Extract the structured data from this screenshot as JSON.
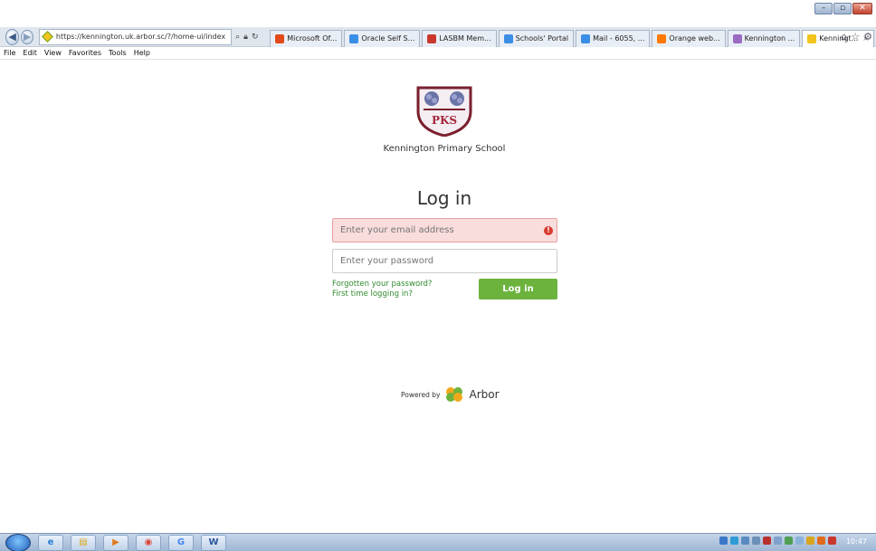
{
  "browser": {
    "address": "https://kennington.uk.arbor.sc/?/home-ui/index",
    "tabs": [
      {
        "label": "Microsoft Of...",
        "color": "#e2491a"
      },
      {
        "label": "Oracle Self S...",
        "color": "#3a8ee6"
      },
      {
        "label": "LASBM Mem...",
        "color": "#c9372c"
      },
      {
        "label": "Schools' Portal",
        "color": "#3a8ee6"
      },
      {
        "label": "Mail - 6055, ...",
        "color": "#3a8ee6"
      },
      {
        "label": "Orange web...",
        "color": "#ff7900"
      },
      {
        "label": "Kennington ...",
        "color": "#9b6bc4"
      },
      {
        "label": "Kenningt...",
        "color": "#f2c51d",
        "active": true
      }
    ],
    "menu": [
      "File",
      "Edit",
      "View",
      "Favorites",
      "Tools",
      "Help"
    ]
  },
  "page": {
    "school_name": "Kennington Primary School",
    "crest_text": "PKS",
    "title": "Log in",
    "email_placeholder": "Enter your email address",
    "password_placeholder": "Enter your password",
    "forgot_link": "Forgotten your password?",
    "first_time_link": "First time logging in?",
    "login_button": "Log in",
    "powered_by": "Powered by",
    "brand": "Arbor"
  },
  "taskbar": {
    "clock": "10:47"
  },
  "colors": {
    "accent_green": "#6cb33e",
    "error_bg": "#f9dcdc",
    "link_green": "#2f8a2f"
  }
}
